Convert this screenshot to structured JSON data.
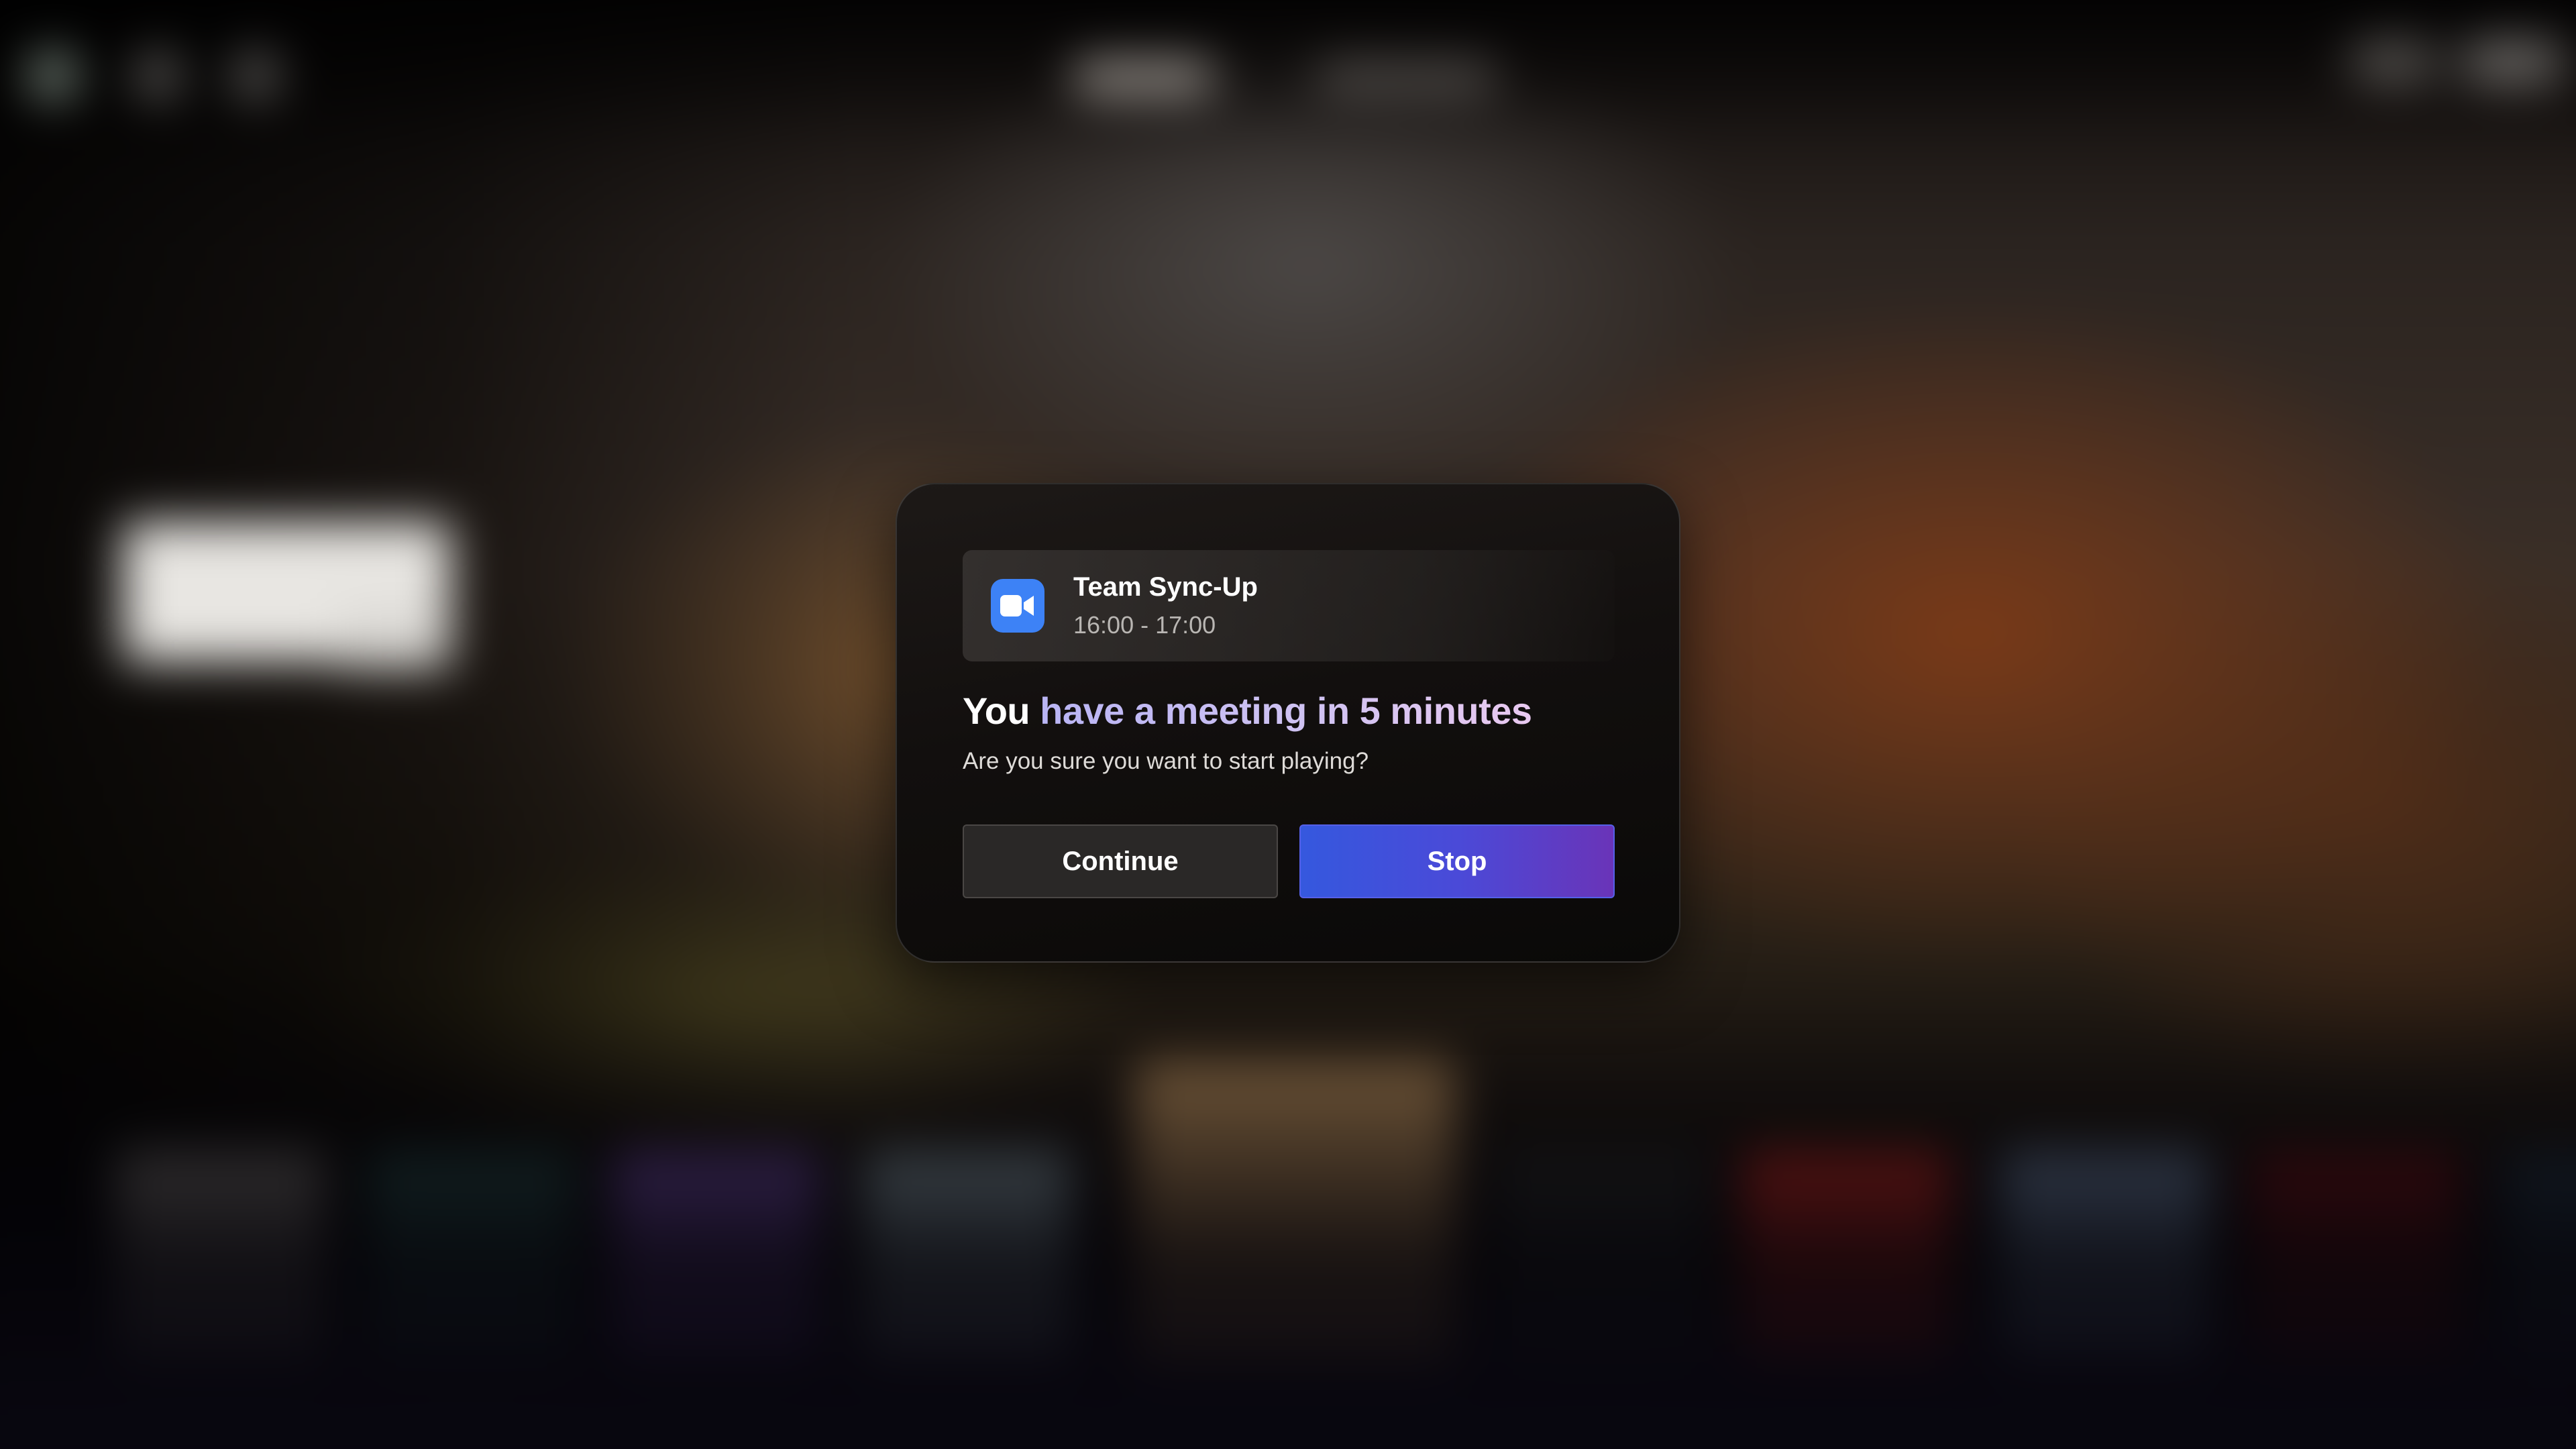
{
  "event": {
    "app_icon": "video-camera-icon",
    "title": "Team Sync-Up",
    "time": "16:00 - 17:00"
  },
  "headline": {
    "lead": "You",
    "highlight": " have a meeting in 5 minutes"
  },
  "subtext": "Are you sure you want to start playing?",
  "buttons": {
    "continue_label": "Continue",
    "stop_label": "Stop"
  },
  "colors": {
    "app_icon_bg": "#3d82f6",
    "stop_gradient_start": "#3558de",
    "stop_gradient_end": "#6a34b8",
    "continue_bg": "#2a2827"
  }
}
